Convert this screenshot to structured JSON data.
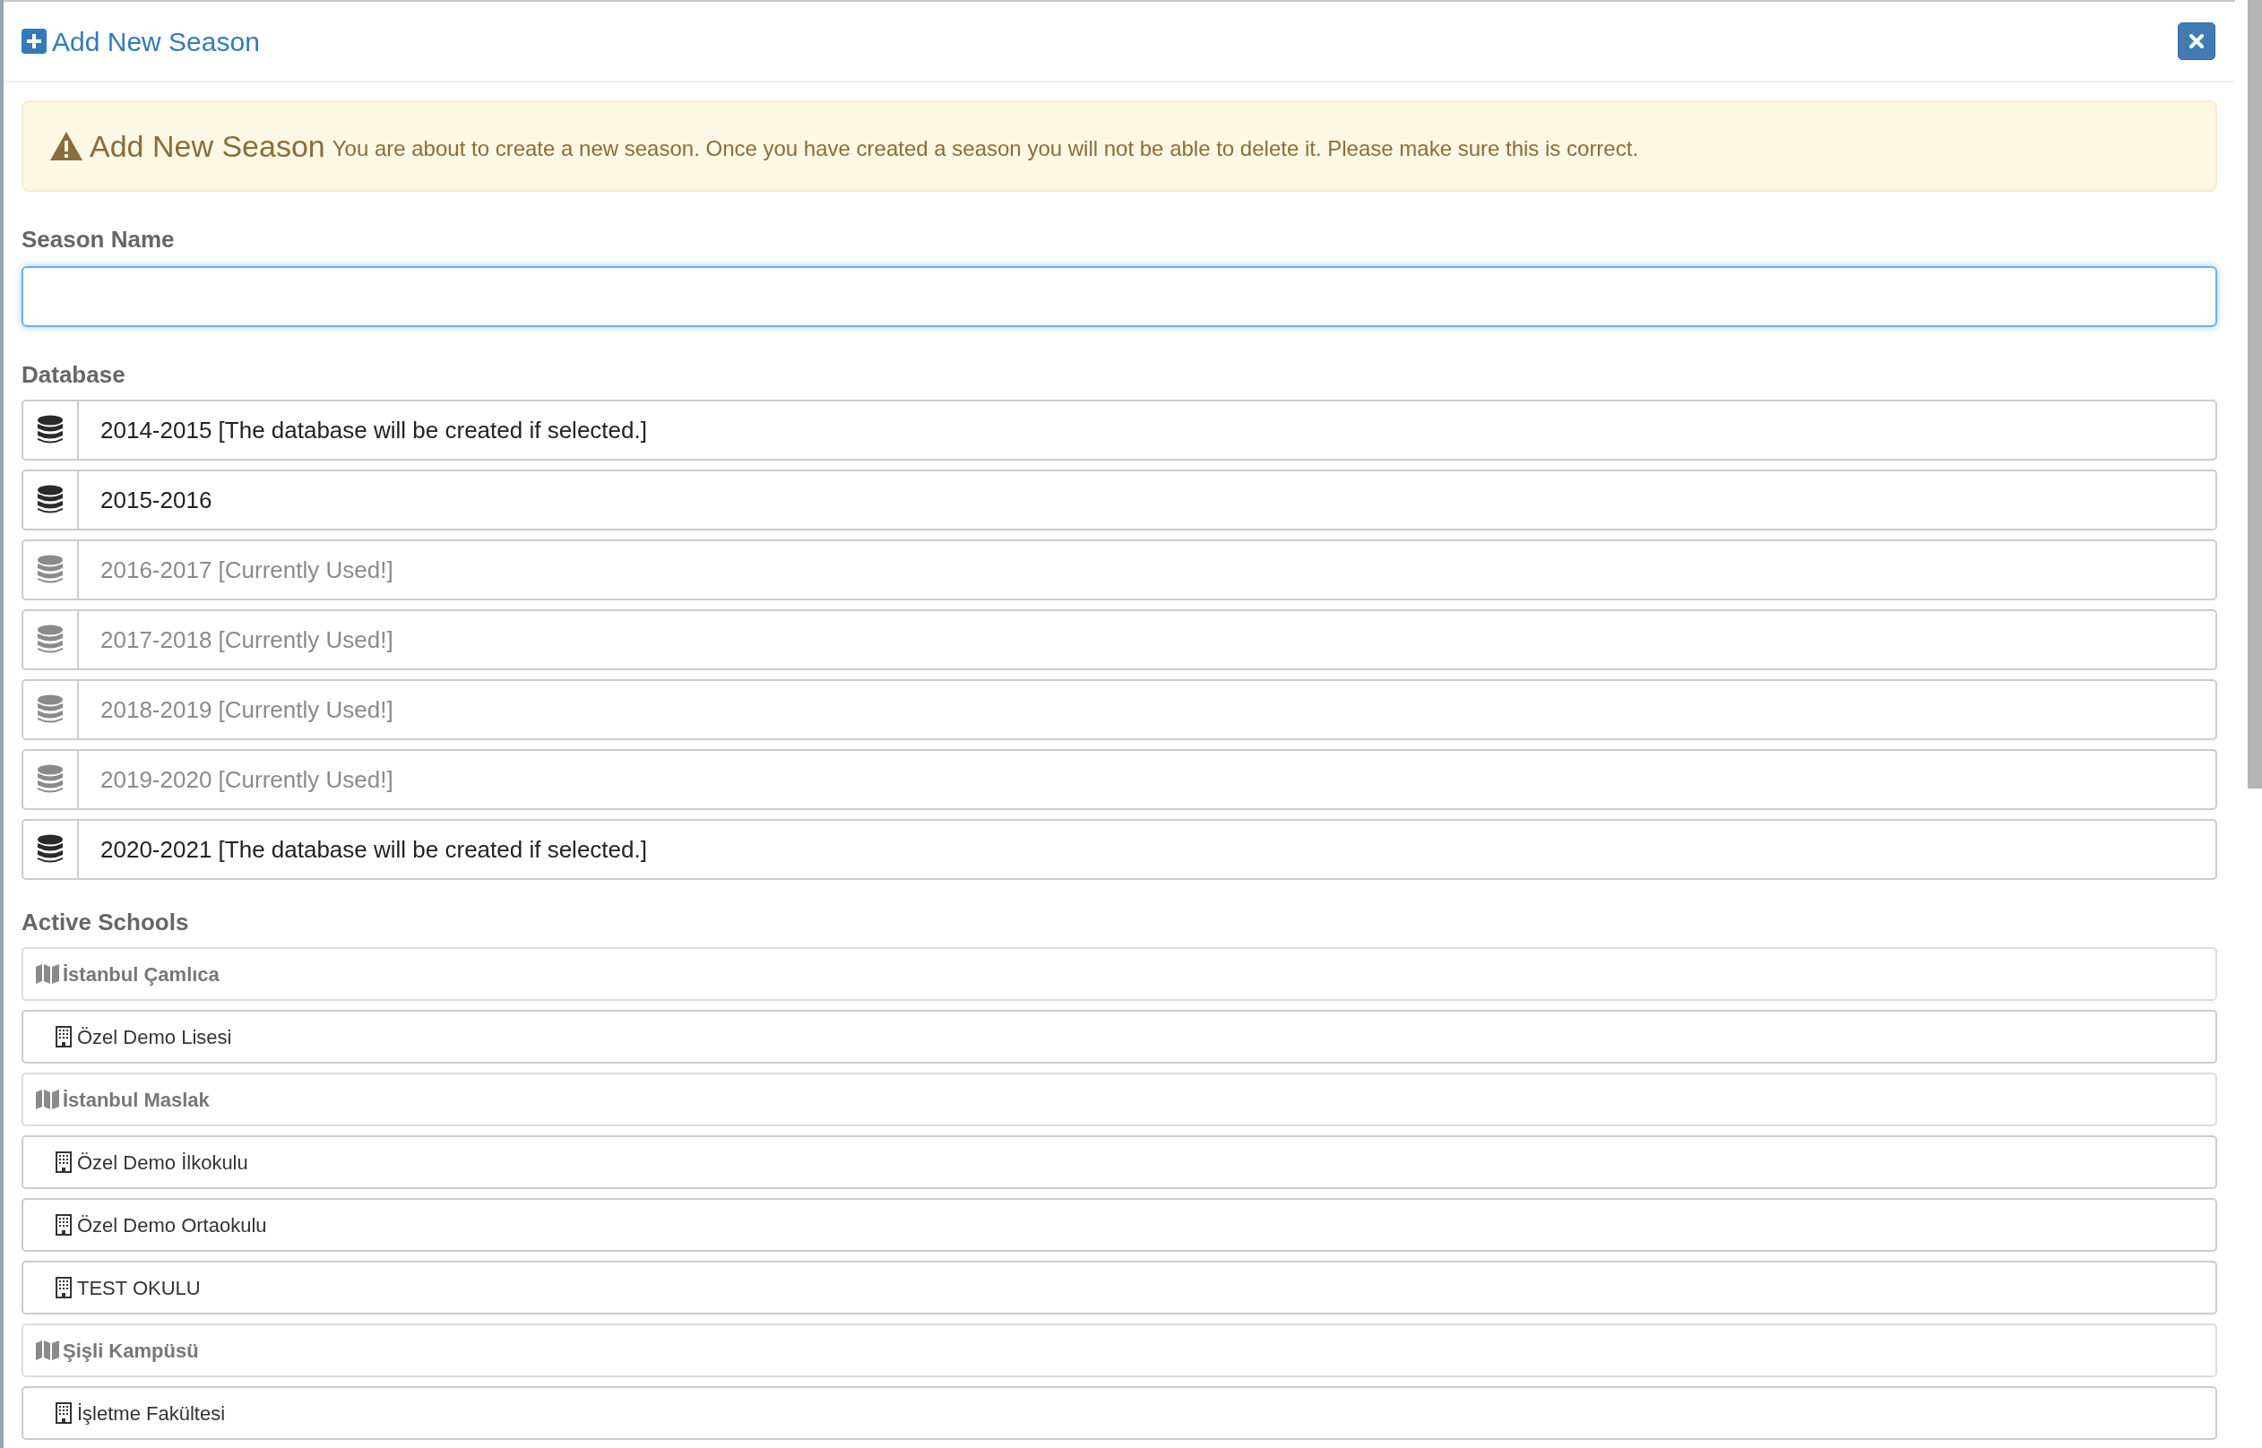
{
  "modal": {
    "title": "Add New Season"
  },
  "alert": {
    "heading": "Add New Season",
    "message": "You are about to create a new season. Once you have created a season you will not be able to delete it. Please make sure this is correct."
  },
  "season_name": {
    "label": "Season Name"
  },
  "database": {
    "label": "Database",
    "items": [
      {
        "label": "2014-2015 [The database will be created if selected.]",
        "disabled": false
      },
      {
        "label": "2015-2016",
        "disabled": false
      },
      {
        "label": "2016-2017 [Currently Used!]",
        "disabled": true
      },
      {
        "label": "2017-2018 [Currently Used!]",
        "disabled": true
      },
      {
        "label": "2018-2019 [Currently Used!]",
        "disabled": true
      },
      {
        "label": "2019-2020 [Currently Used!]",
        "disabled": true
      },
      {
        "label": "2020-2021 [The database will be created if selected.]",
        "disabled": false
      }
    ]
  },
  "active_schools": {
    "label": "Active Schools",
    "campuses": [
      {
        "name": "İstanbul Çamlıca",
        "children": [
          {
            "name": "Özel Demo Lisesi"
          }
        ]
      },
      {
        "name": "İstanbul Maslak",
        "children": [
          {
            "name": "Özel Demo İlkokulu"
          },
          {
            "name": "Özel Demo Ortaokulu"
          },
          {
            "name": "TEST OKULU"
          }
        ]
      },
      {
        "name": "Şişli Kampüsü",
        "children": [
          {
            "name": "İşletme Fakültesi"
          }
        ]
      }
    ]
  }
}
